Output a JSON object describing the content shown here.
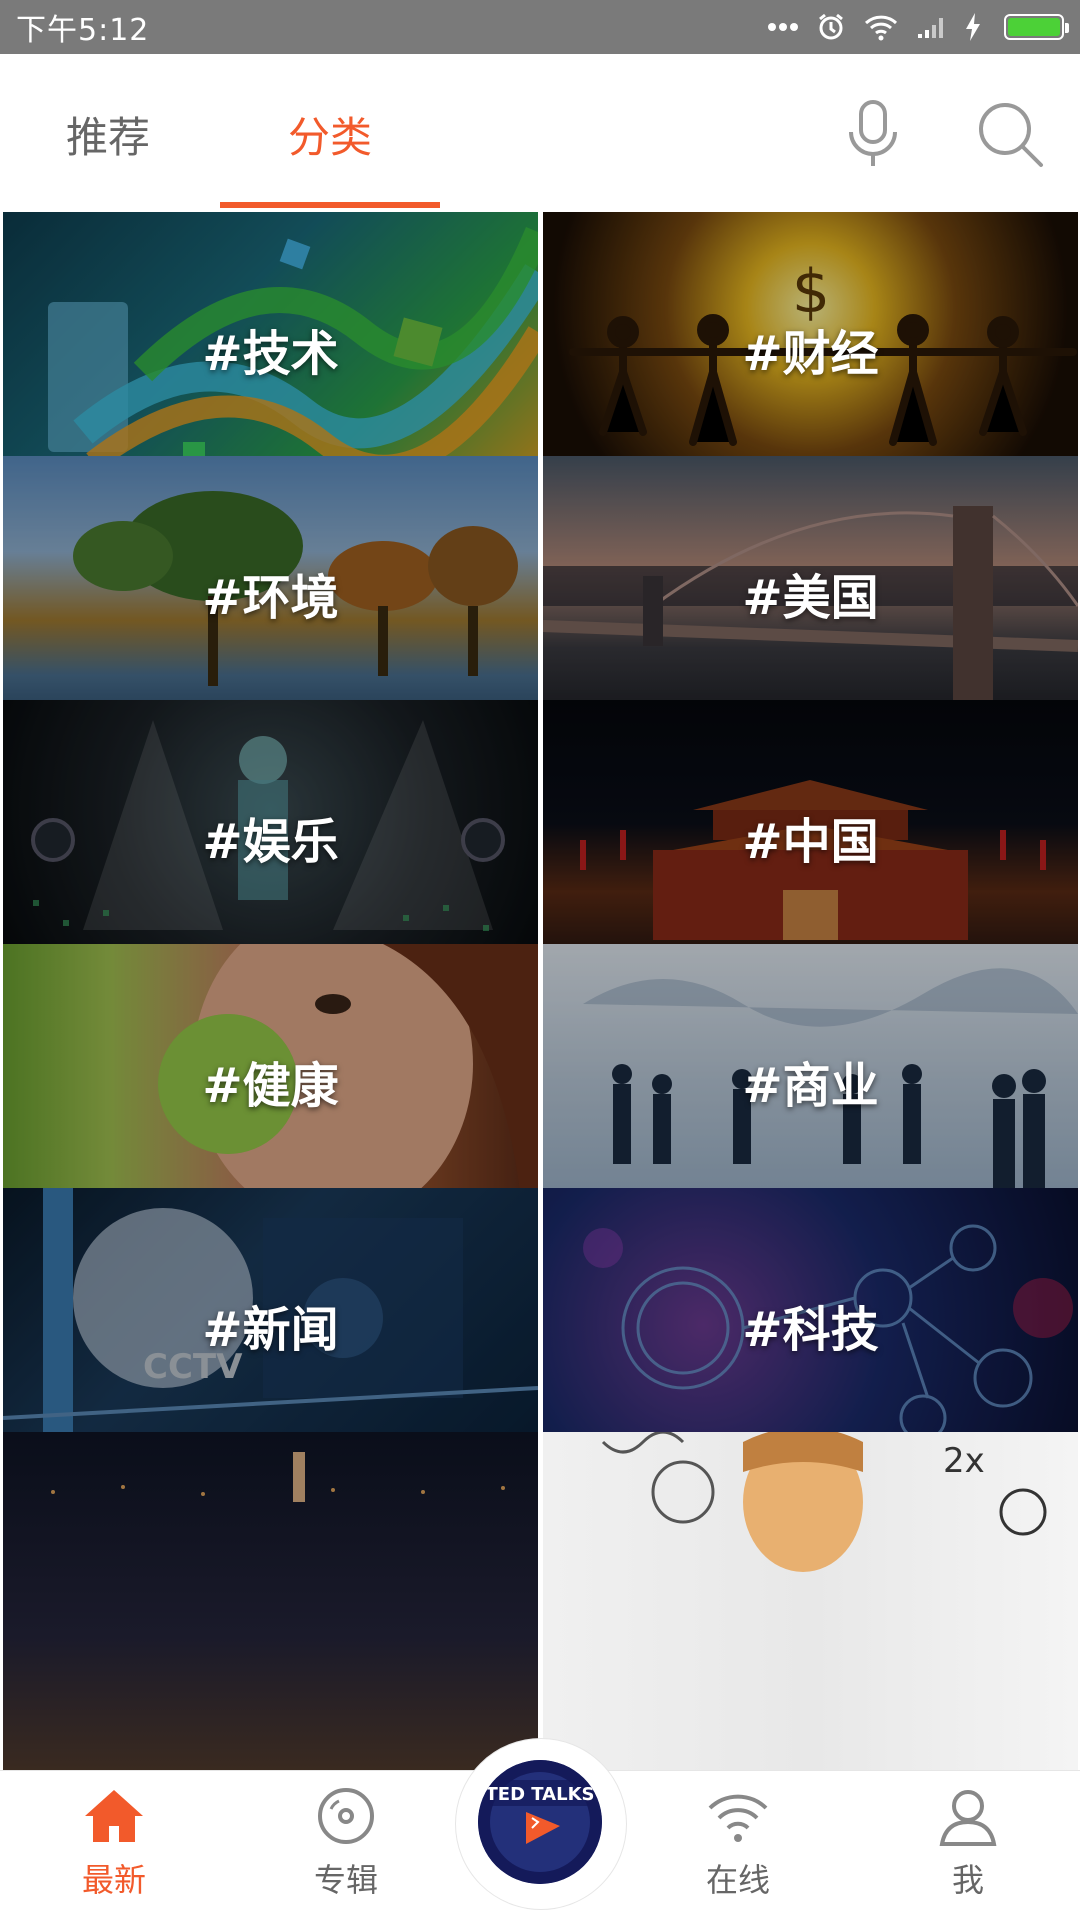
{
  "status_bar": {
    "time": "下午5:12",
    "icons": [
      "more-dots-icon",
      "alarm-icon",
      "wifi-icon",
      "signal-icon",
      "charging-icon",
      "battery-icon"
    ],
    "battery_level": 1.0,
    "battery_color": "#4cd137"
  },
  "top_bar": {
    "tabs": [
      {
        "label": "推荐",
        "active": false
      },
      {
        "label": "分类",
        "active": true
      }
    ],
    "accent_color": "#f25a2b",
    "icons": [
      "microphone-icon",
      "search-icon"
    ]
  },
  "categories": [
    {
      "label": "#技术"
    },
    {
      "label": "#财经"
    },
    {
      "label": "#环境"
    },
    {
      "label": "#美国"
    },
    {
      "label": "#娱乐"
    },
    {
      "label": "#中国"
    },
    {
      "label": "#健康"
    },
    {
      "label": "#商业"
    },
    {
      "label": "#新闻"
    },
    {
      "label": "#科技"
    },
    {
      "label": ""
    },
    {
      "label": ""
    }
  ],
  "bottom_nav": {
    "items": [
      {
        "label": "最新",
        "icon": "home-icon",
        "active": true
      },
      {
        "label": "专辑",
        "icon": "disc-icon",
        "active": false
      },
      {
        "label": "在线",
        "icon": "broadcast-icon",
        "active": false
      },
      {
        "label": "我",
        "icon": "user-icon",
        "active": false
      }
    ],
    "center_button": {
      "icon": "ted-play-icon",
      "brand_text": "TED TALKS"
    }
  }
}
